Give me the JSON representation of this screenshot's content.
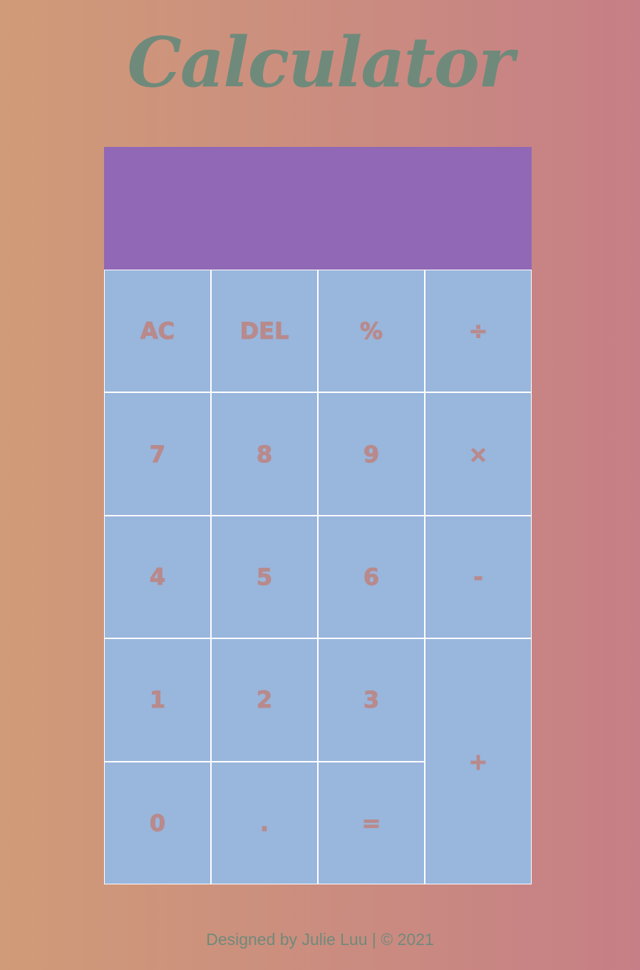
{
  "page": {
    "title": "Calculator",
    "footer": "Designed by Julie Luu | © 2021"
  },
  "display": {
    "previous_operand": "",
    "current_operand": ""
  },
  "keys": [
    {
      "label": "AC",
      "name": "all-clear-button"
    },
    {
      "label": "DEL",
      "name": "delete-button"
    },
    {
      "label": "%",
      "name": "percent-button"
    },
    {
      "label": "÷",
      "name": "divide-button"
    },
    {
      "label": "7",
      "name": "digit-7-button"
    },
    {
      "label": "8",
      "name": "digit-8-button"
    },
    {
      "label": "9",
      "name": "digit-9-button"
    },
    {
      "label": "×",
      "name": "multiply-button"
    },
    {
      "label": "4",
      "name": "digit-4-button"
    },
    {
      "label": "5",
      "name": "digit-5-button"
    },
    {
      "label": "6",
      "name": "digit-6-button"
    },
    {
      "label": "-",
      "name": "subtract-button"
    },
    {
      "label": "1",
      "name": "digit-1-button"
    },
    {
      "label": "2",
      "name": "digit-2-button"
    },
    {
      "label": "3",
      "name": "digit-3-button"
    },
    {
      "label": "+",
      "name": "add-button"
    },
    {
      "label": "0",
      "name": "digit-0-button"
    },
    {
      "label": ".",
      "name": "decimal-button"
    },
    {
      "label": "=",
      "name": "equals-button"
    }
  ],
  "colors": {
    "background_start": "#d09b78",
    "background_end": "#c67f86",
    "title": "#6f8a7b",
    "display": "#9068b6",
    "key_background": "#99b6dc",
    "key_text": "#b88a8c",
    "key_border": "#ffffff"
  }
}
